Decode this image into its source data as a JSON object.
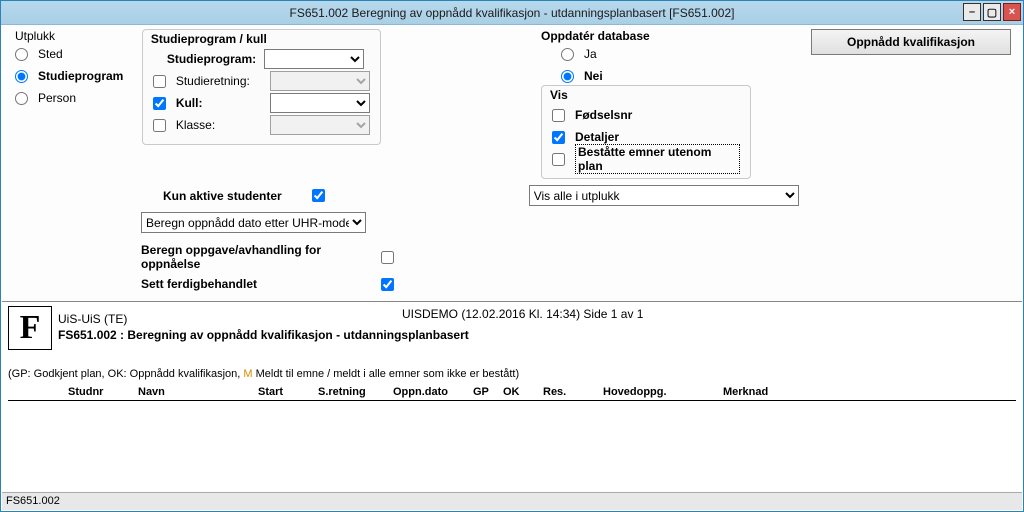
{
  "window": {
    "title": "FS651.002 Beregning av oppnådd kvalifikasjon - utdanningsplanbasert [FS651.002]"
  },
  "utplukk": {
    "legend": "Utplukk",
    "sted": "Sted",
    "studieprogram": "Studieprogram",
    "person": "Person"
  },
  "studie": {
    "legend": "Studieprogram / kull",
    "studieprogram": "Studieprogram:",
    "studieretning": "Studieretning:",
    "kull": "Kull:",
    "klasse": "Klasse:"
  },
  "oppdater": {
    "legend": "Oppdatér database",
    "ja": "Ja",
    "nei": "Nei"
  },
  "vis": {
    "legend": "Vis",
    "fodselsnr": "Fødselsnr",
    "detaljer": "Detaljer",
    "bestatte": "Beståtte emner utenom plan"
  },
  "button": {
    "oppnadd": "Oppnådd kvalifikasjon"
  },
  "options": {
    "kun_aktive": "Kun aktive studenter",
    "vis_alle": "Vis alle i utplukk",
    "beregn_modell": "Beregn oppnådd dato etter UHR-modell",
    "beregn_oppgave": "Beregn oppgave/avhandling for oppnåelse",
    "sett_ferdig": "Sett ferdigbehandlet"
  },
  "report": {
    "org": "UiS-UiS  (TE)",
    "meta": "UISDEMO  (12.02.2016 Kl. 14:34)  Side 1 av 1",
    "title": "FS651.002 : Beregning av oppnådd kvalifikasjon - utdanningsplanbasert",
    "note_pre": "(GP: Godkjent plan, OK: Oppnådd kvalifikasjon, ",
    "note_m": "M",
    "note_post": " Meldt til emne / meldt i alle emner som ikke er bestått)",
    "cols": {
      "studnr": "Studnr",
      "navn": "Navn",
      "start": "Start",
      "sretning": "S.retning",
      "oppndato": "Oppn.dato",
      "gp": "GP",
      "ok": "OK",
      "res": "Res.",
      "hovedoppg": "Hovedoppg.",
      "merknad": "Merknad"
    }
  },
  "status": {
    "text": "FS651.002"
  }
}
